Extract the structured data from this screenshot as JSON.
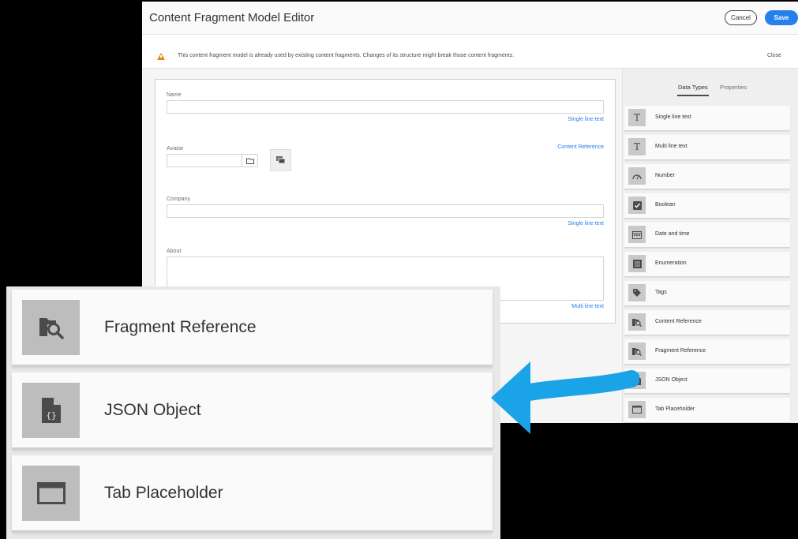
{
  "editor": {
    "title": "Content Fragment Model Editor",
    "cancel_label": "Cancel",
    "save_label": "Save",
    "alert": {
      "message": "This content fragment model is already used by existing content fragments. Changes of its structure might break those content fragments.",
      "close_label": "Close"
    },
    "form": {
      "name": {
        "label": "Name",
        "type": "Single line text"
      },
      "avatar": {
        "label": "Avatar",
        "type": "Content Reference"
      },
      "company": {
        "label": "Company",
        "type": "Single line text"
      },
      "about": {
        "label": "About",
        "type": "Multi line text"
      }
    },
    "panel": {
      "tabs": [
        "Data Types",
        "Properties"
      ],
      "active_tab": "Data Types",
      "data_types": [
        {
          "label": "Single line text",
          "icon": "text-icon"
        },
        {
          "label": "Multi line text",
          "icon": "text-icon"
        },
        {
          "label": "Number",
          "icon": "gauge-icon"
        },
        {
          "label": "Boolean",
          "icon": "checkbox-icon"
        },
        {
          "label": "Date and time",
          "icon": "calendar-icon"
        },
        {
          "label": "Enumeration",
          "icon": "list-icon"
        },
        {
          "label": "Tags",
          "icon": "tag-icon"
        },
        {
          "label": "Content Reference",
          "icon": "folder-search-icon"
        },
        {
          "label": "Fragment Reference",
          "icon": "folder-search-icon"
        },
        {
          "label": "JSON Object",
          "icon": "json-file-icon"
        },
        {
          "label": "Tab Placeholder",
          "icon": "tab-window-icon"
        }
      ]
    }
  },
  "zoom": {
    "items": [
      {
        "label": "Fragment Reference",
        "icon": "folder-search-icon"
      },
      {
        "label": "JSON Object",
        "icon": "json-file-icon"
      },
      {
        "label": "Tab Placeholder",
        "icon": "tab-window-icon"
      }
    ]
  },
  "colors": {
    "accent": "#2680eb",
    "arrow": "#1ba3e8",
    "warning": "#e68619"
  }
}
